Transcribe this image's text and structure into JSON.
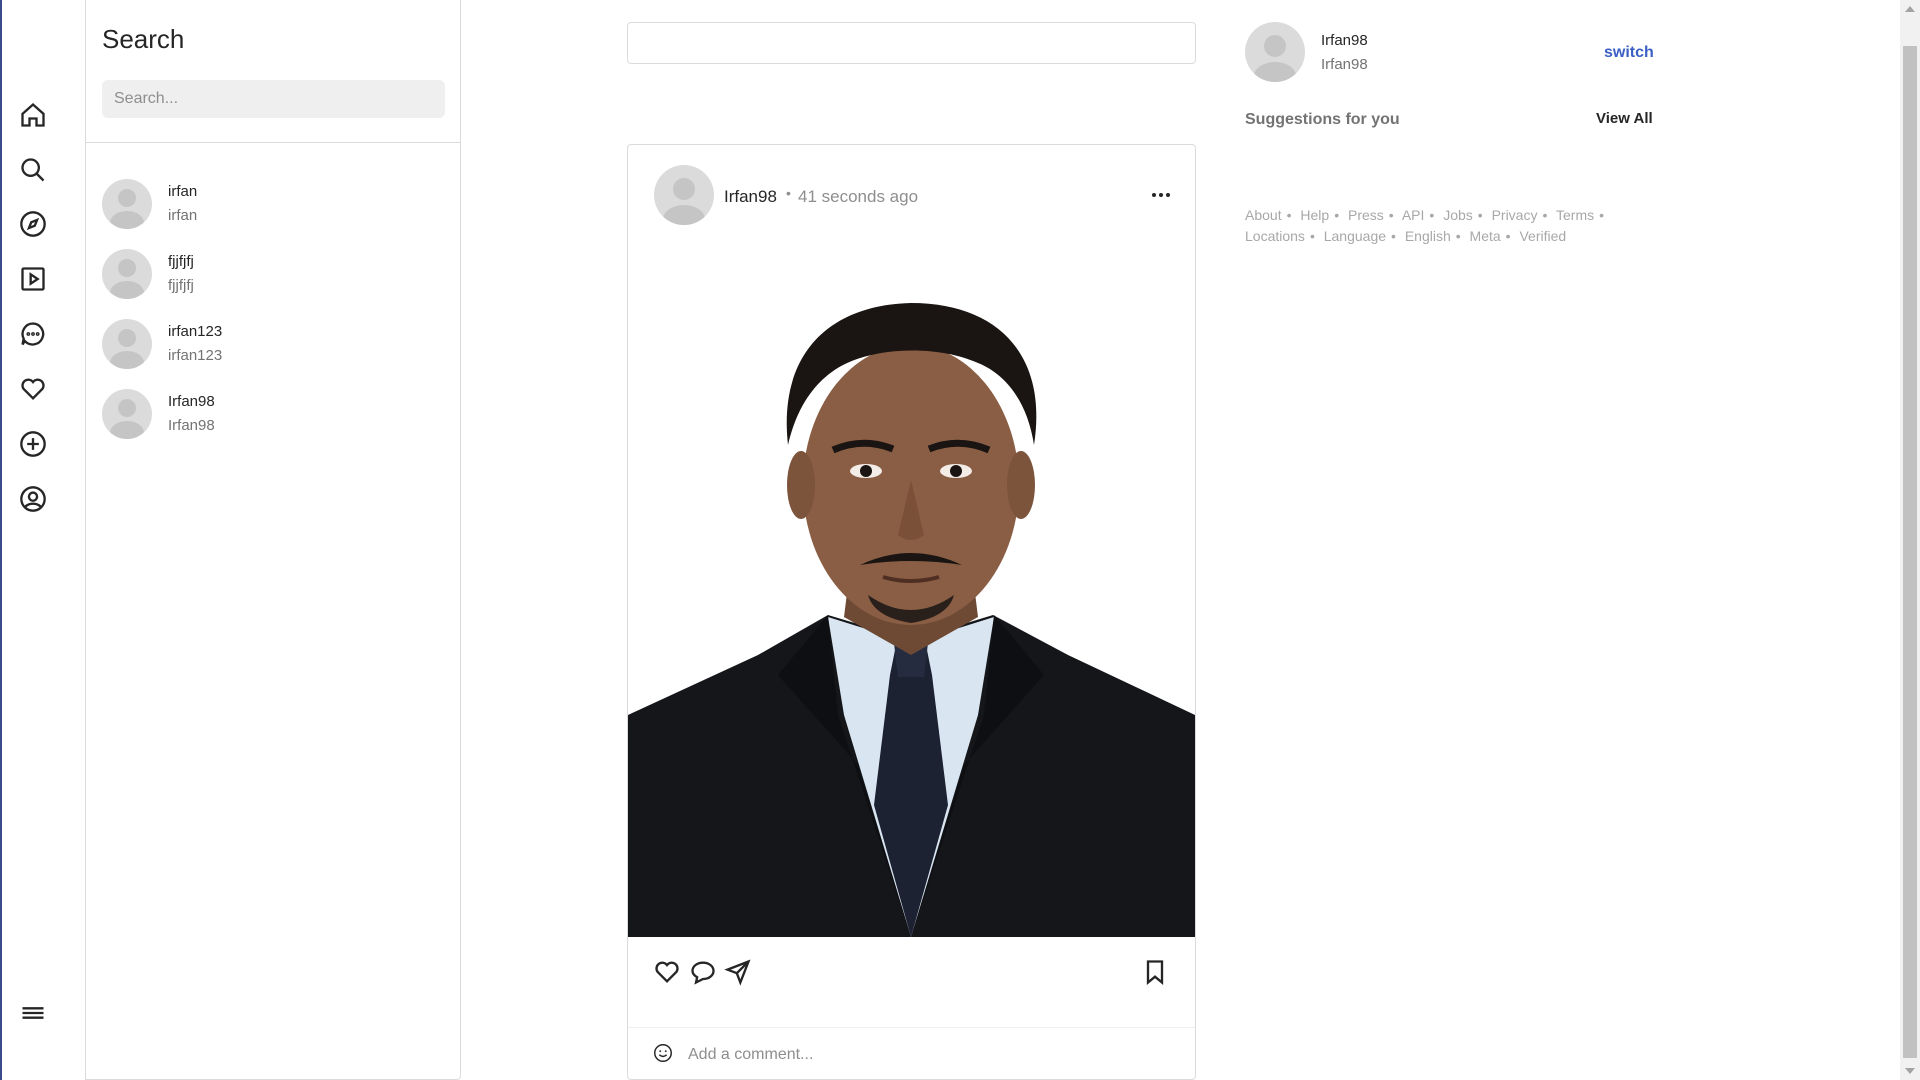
{
  "nav": {
    "items": [
      {
        "icon": "home-icon"
      },
      {
        "icon": "search-icon"
      },
      {
        "icon": "explore-icon"
      },
      {
        "icon": "reels-icon"
      },
      {
        "icon": "messages-icon"
      },
      {
        "icon": "heart-icon"
      },
      {
        "icon": "create-icon"
      },
      {
        "icon": "profile-icon"
      }
    ],
    "menu_icon": "menu-icon"
  },
  "search": {
    "title": "Search",
    "placeholder": "Search...",
    "results": [
      {
        "username": "irfan",
        "name": "irfan"
      },
      {
        "username": "fjjfjfj",
        "name": "fjjfjfj"
      },
      {
        "username": "irfan123",
        "name": "irfan123"
      },
      {
        "username": "Irfan98",
        "name": "Irfan98"
      }
    ]
  },
  "post": {
    "username": "Irfan98",
    "separator": "•",
    "time": "41 seconds ago",
    "comment_placeholder": "Add a comment..."
  },
  "profile": {
    "username": "Irfan98",
    "name": "Irfan98",
    "switch_label": "switch"
  },
  "suggestions": {
    "title": "Suggestions for you",
    "view_all": "View All"
  },
  "footer": {
    "links": [
      "About",
      "Help",
      "Press",
      "API",
      "Jobs",
      "Privacy",
      "Terms",
      "Locations",
      "Language",
      "English",
      "Meta",
      "Verified"
    ]
  },
  "colors": {
    "accent": "#3b5fc4",
    "border": "#dbdbdb",
    "muted": "#8e8e8e"
  }
}
